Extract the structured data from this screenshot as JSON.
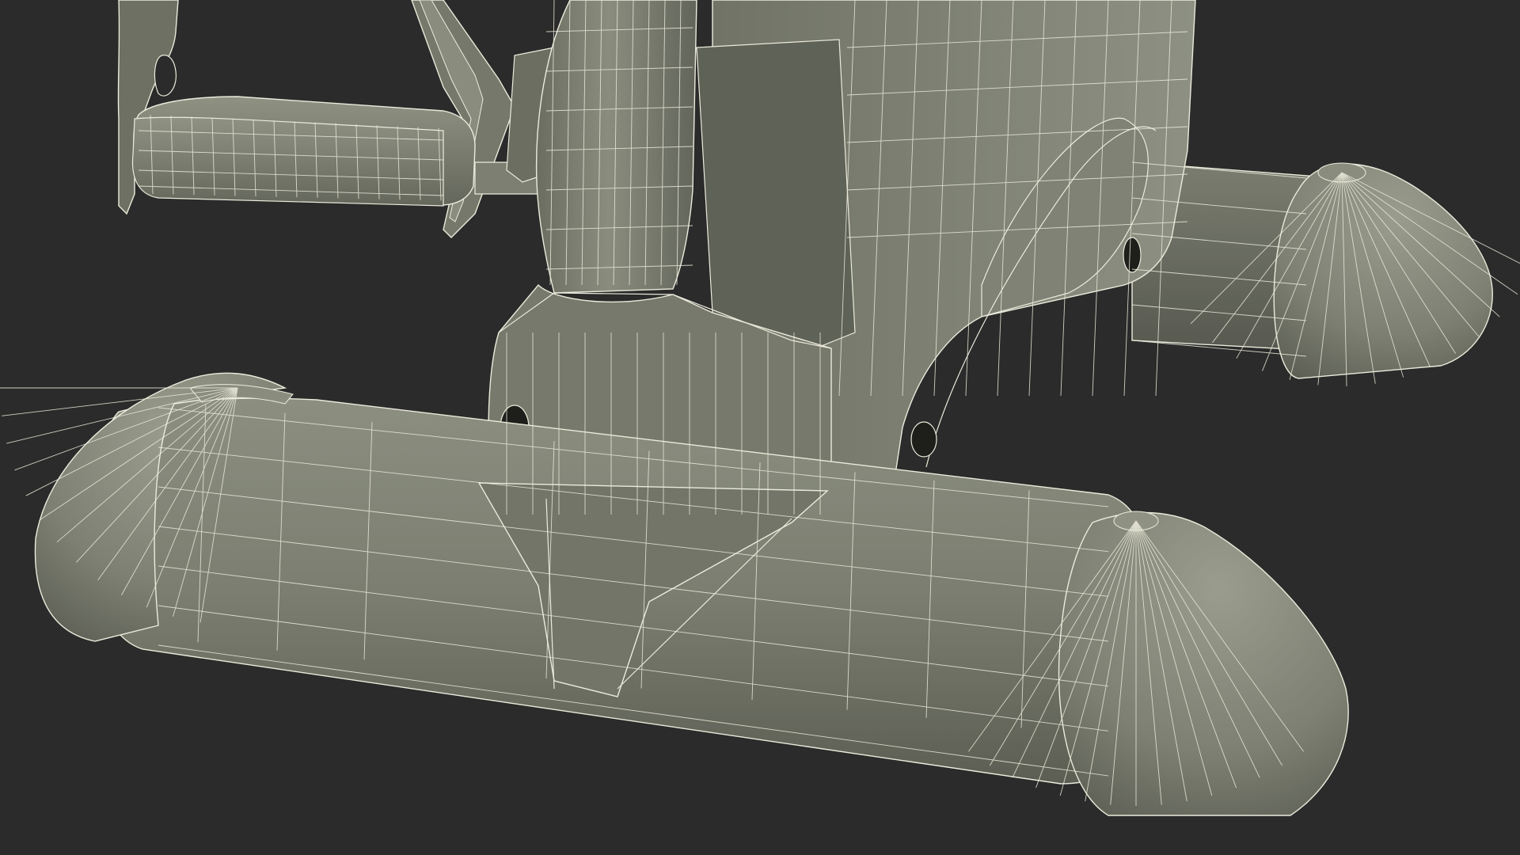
{
  "scene": {
    "subject": "exercise-bike-base-wireframe",
    "colors": {
      "background": "#2b2b2b",
      "surface_dark": "#5f6155",
      "surface_mid": "#6f7264",
      "surface_light": "#85887a",
      "surface_highlight": "#979a8b",
      "wire": "#ecebdc",
      "hole": "#1e1f1b"
    }
  }
}
